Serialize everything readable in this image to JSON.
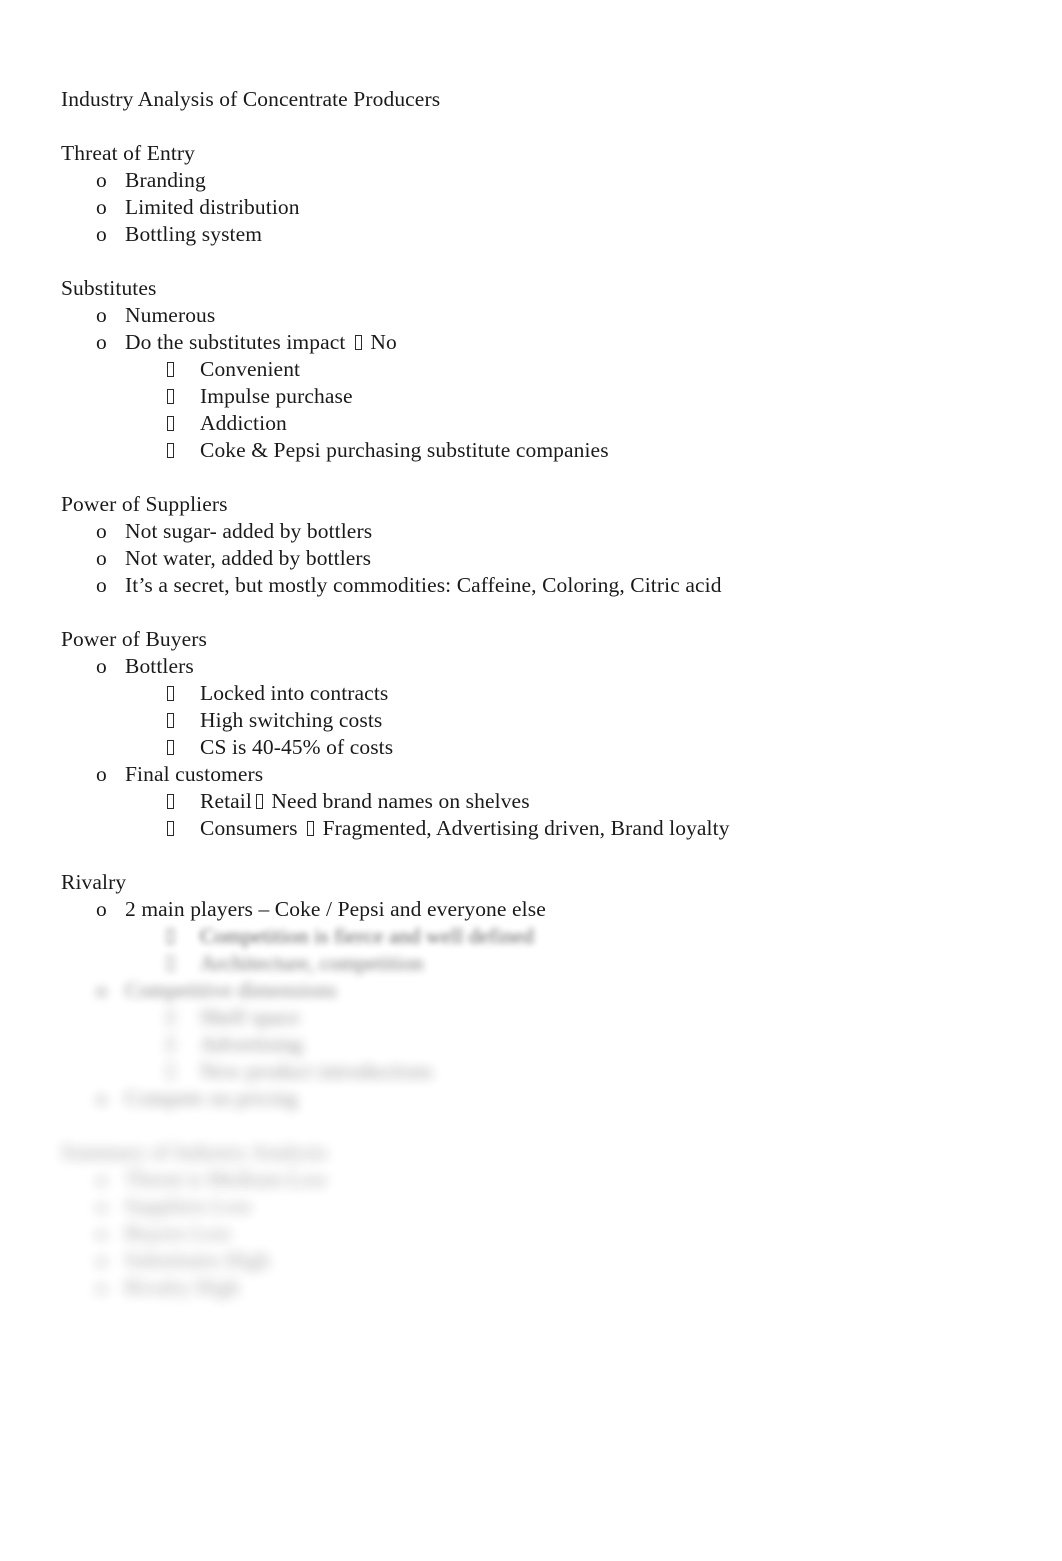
{
  "document": {
    "title": "Industry Analysis of Concentrate Producers",
    "sections": [
      {
        "heading": "Threat of Entry",
        "items": [
          {
            "level": 1,
            "text": "Branding"
          },
          {
            "level": 1,
            "text": "Limited distribution"
          },
          {
            "level": 1,
            "text": "Bottling system"
          }
        ]
      },
      {
        "heading": "Substitutes",
        "items": [
          {
            "level": 1,
            "text": "Numerous"
          },
          {
            "level": 1,
            "text_before": "Do the substitutes impact ",
            "text_after": " No"
          },
          {
            "level": 2,
            "text": "Convenient"
          },
          {
            "level": 2,
            "text": "Impulse purchase"
          },
          {
            "level": 2,
            "text": "Addiction"
          },
          {
            "level": 2,
            "text": "Coke & Pepsi purchasing substitute companies"
          }
        ]
      },
      {
        "heading": "Power of Suppliers",
        "items": [
          {
            "level": 1,
            "text": "Not sugar- added by bottlers"
          },
          {
            "level": 1,
            "text": "Not water, added by bottlers"
          },
          {
            "level": 1,
            "text": "It’s a secret, but mostly commodities: Caffeine, Coloring, Citric acid"
          }
        ]
      },
      {
        "heading": "Power of Buyers",
        "items": [
          {
            "level": 1,
            "text": "Bottlers"
          },
          {
            "level": 2,
            "text": "Locked into contracts"
          },
          {
            "level": 2,
            "text": "High switching costs"
          },
          {
            "level": 2,
            "text": "CS is 40-45% of costs"
          },
          {
            "level": 1,
            "text": "Final customers"
          },
          {
            "level": 2,
            "text_before": "Retail",
            "text_after": " Need brand names on shelves"
          },
          {
            "level": 2,
            "text_before": "Consumers ",
            "text_after": " Fragmented, Advertising driven, Brand loyalty"
          }
        ]
      },
      {
        "heading": "Rivalry",
        "items": [
          {
            "level": 1,
            "text": "2 main players – Coke / Pepsi and everyone else"
          }
        ]
      }
    ]
  },
  "degraded": {
    "note": "lower portion of page is blurred/illegible in the source image",
    "rivalry_rest": [
      {
        "level": 2,
        "text": "Competition is fierce and well defined"
      },
      {
        "level": 2,
        "text": "Architecture, competition"
      },
      {
        "level": 1,
        "text": "Competitive dimensions"
      },
      {
        "level": 2,
        "text": "Shelf space"
      },
      {
        "level": 2,
        "text": "Advertising"
      },
      {
        "level": 2,
        "text": "New product introductions"
      },
      {
        "level": 1,
        "text": "Compete on pricing"
      }
    ],
    "summary_heading": "Summary of Industry Analysis",
    "summary_items": [
      {
        "level": 1,
        "text": "Threat is Medium-Low"
      },
      {
        "level": 1,
        "text": "Suppliers Low"
      },
      {
        "level": 1,
        "text": "Buyers Low"
      },
      {
        "level": 1,
        "text": "Substitutes High"
      },
      {
        "level": 1,
        "text": "Rivalry High"
      }
    ]
  },
  "colors": {
    "text": "#1a1a1a",
    "background": "#ffffff"
  }
}
